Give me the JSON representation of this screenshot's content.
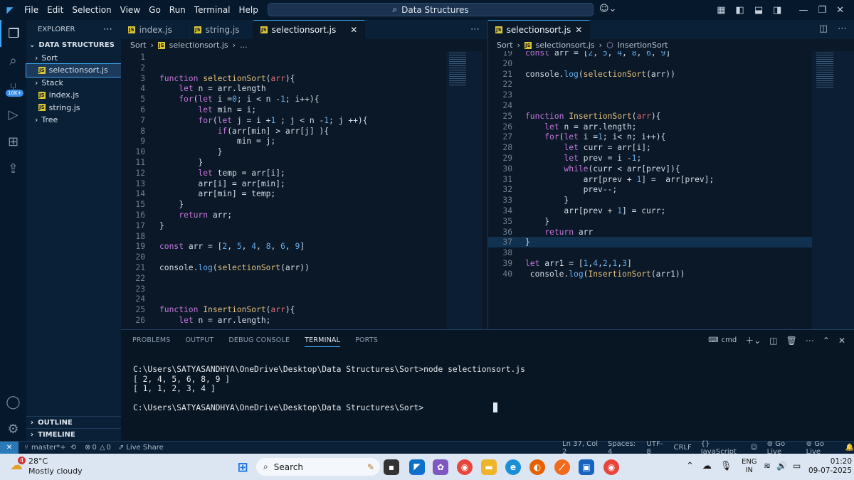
{
  "menu": [
    "File",
    "Edit",
    "Selection",
    "View",
    "Go",
    "Run",
    "Terminal",
    "Help"
  ],
  "search_text": "Data Structures",
  "explorer": {
    "title": "EXPLORER",
    "root": "DATA STRUCTURES",
    "items": [
      {
        "label": "Sort",
        "type": "folder",
        "depth": 0
      },
      {
        "label": "selectionsort.js",
        "type": "file",
        "depth": 1
      },
      {
        "label": "Stack",
        "type": "folder",
        "depth": 0
      },
      {
        "label": "index.js",
        "type": "file",
        "depth": 1
      },
      {
        "label": "string.js",
        "type": "file",
        "depth": 1
      },
      {
        "label": "Tree",
        "type": "folder",
        "depth": 0
      }
    ],
    "outline": "OUTLINE",
    "timeline": "TIMELINE"
  },
  "activity_badge": "10K+",
  "left_tabs": [
    "index.js",
    "string.js",
    "selectionsort.js"
  ],
  "left_breadcrumb": [
    "Sort",
    "selectionsort.js",
    "..."
  ],
  "right_tab": "selectionsort.js",
  "right_breadcrumb": [
    "Sort",
    "selectionsort.js",
    "InsertionSort"
  ],
  "left_code": [
    {
      "n": "1",
      "c": []
    },
    {
      "n": "2",
      "c": []
    },
    {
      "n": "3",
      "c": [
        [
          "k",
          "function "
        ],
        [
          "f",
          "selectionSort"
        ],
        [
          "p",
          "("
        ],
        [
          "v",
          "arr"
        ],
        [
          "p",
          "){"
        ]
      ]
    },
    {
      "n": "4",
      "c": [
        [
          "p",
          "    "
        ],
        [
          "k",
          "let "
        ],
        [
          "p",
          "n = arr.length"
        ]
      ]
    },
    {
      "n": "5",
      "c": [
        [
          "p",
          "    "
        ],
        [
          "k",
          "for"
        ],
        [
          "p",
          "("
        ],
        [
          "k",
          "let "
        ],
        [
          "p",
          "i ="
        ],
        [
          "n",
          "0"
        ],
        [
          "p",
          "; i < n -"
        ],
        [
          "n",
          "1"
        ],
        [
          "p",
          "; i++){"
        ]
      ]
    },
    {
      "n": "6",
      "c": [
        [
          "p",
          "        "
        ],
        [
          "k",
          "let "
        ],
        [
          "p",
          "min = i;"
        ]
      ]
    },
    {
      "n": "7",
      "c": [
        [
          "p",
          "        "
        ],
        [
          "k",
          "for"
        ],
        [
          "p",
          "("
        ],
        [
          "k",
          "let "
        ],
        [
          "p",
          "j = i +"
        ],
        [
          "n",
          "1"
        ],
        [
          "p",
          " ; j < n -"
        ],
        [
          "n",
          "1"
        ],
        [
          "p",
          "; j ++){"
        ]
      ]
    },
    {
      "n": "8",
      "c": [
        [
          "p",
          "            "
        ],
        [
          "k",
          "if"
        ],
        [
          "p",
          "(arr[min] > arr[j] ){"
        ]
      ]
    },
    {
      "n": "9",
      "c": [
        [
          "p",
          "                min = j;"
        ]
      ]
    },
    {
      "n": "10",
      "c": [
        [
          "p",
          "            }"
        ]
      ]
    },
    {
      "n": "11",
      "c": [
        [
          "p",
          "        }"
        ]
      ]
    },
    {
      "n": "12",
      "c": [
        [
          "p",
          "        "
        ],
        [
          "k",
          "let "
        ],
        [
          "p",
          "temp = arr[i];"
        ]
      ]
    },
    {
      "n": "13",
      "c": [
        [
          "p",
          "        arr[i] = arr[min];"
        ]
      ]
    },
    {
      "n": "14",
      "c": [
        [
          "p",
          "        arr[min] = temp;"
        ]
      ]
    },
    {
      "n": "15",
      "c": [
        [
          "p",
          "    }"
        ]
      ]
    },
    {
      "n": "16",
      "c": [
        [
          "p",
          "    "
        ],
        [
          "k",
          "return "
        ],
        [
          "p",
          "arr;"
        ]
      ]
    },
    {
      "n": "17",
      "c": [
        [
          "p",
          "}"
        ]
      ]
    },
    {
      "n": "18",
      "c": []
    },
    {
      "n": "19",
      "c": [
        [
          "k",
          "const "
        ],
        [
          "p",
          "arr = ["
        ],
        [
          "n",
          "2"
        ],
        [
          "p",
          ", "
        ],
        [
          "n",
          "5"
        ],
        [
          "p",
          ", "
        ],
        [
          "n",
          "4"
        ],
        [
          "p",
          ", "
        ],
        [
          "n",
          "8"
        ],
        [
          "p",
          ", "
        ],
        [
          "n",
          "6"
        ],
        [
          "p",
          ", "
        ],
        [
          "n",
          "9"
        ],
        [
          "p",
          "]"
        ]
      ]
    },
    {
      "n": "20",
      "c": []
    },
    {
      "n": "21",
      "c": [
        [
          "p",
          "console."
        ],
        [
          "n",
          "log"
        ],
        [
          "p",
          "("
        ],
        [
          "f",
          "selectionSort"
        ],
        [
          "p",
          "(arr))"
        ]
      ]
    },
    {
      "n": "22",
      "c": []
    },
    {
      "n": "23",
      "c": []
    },
    {
      "n": "24",
      "c": []
    },
    {
      "n": "25",
      "c": [
        [
          "k",
          "function "
        ],
        [
          "f",
          "InsertionSort"
        ],
        [
          "p",
          "("
        ],
        [
          "v",
          "arr"
        ],
        [
          "p",
          "){"
        ]
      ]
    },
    {
      "n": "26",
      "c": [
        [
          "p",
          "    "
        ],
        [
          "k",
          "let "
        ],
        [
          "p",
          "n = arr.length;"
        ]
      ]
    }
  ],
  "right_code": [
    {
      "n": "19",
      "c": [
        [
          "k",
          "const "
        ],
        [
          "p",
          "arr = ["
        ],
        [
          "n",
          "2"
        ],
        [
          "p",
          ", "
        ],
        [
          "n",
          "5"
        ],
        [
          "p",
          ", "
        ],
        [
          "n",
          "4"
        ],
        [
          "p",
          ", "
        ],
        [
          "n",
          "8"
        ],
        [
          "p",
          ", "
        ],
        [
          "n",
          "6"
        ],
        [
          "p",
          ", "
        ],
        [
          "n",
          "9"
        ],
        [
          "p",
          "]"
        ]
      ]
    },
    {
      "n": "20",
      "c": []
    },
    {
      "n": "21",
      "c": [
        [
          "p",
          "console."
        ],
        [
          "n",
          "log"
        ],
        [
          "p",
          "("
        ],
        [
          "f",
          "selectionSort"
        ],
        [
          "p",
          "(arr))"
        ]
      ]
    },
    {
      "n": "22",
      "c": []
    },
    {
      "n": "23",
      "c": []
    },
    {
      "n": "24",
      "c": []
    },
    {
      "n": "25",
      "c": [
        [
          "k",
          "function "
        ],
        [
          "f",
          "InsertionSort"
        ],
        [
          "p",
          "("
        ],
        [
          "v",
          "arr"
        ],
        [
          "p",
          "){"
        ]
      ]
    },
    {
      "n": "26",
      "c": [
        [
          "p",
          "    "
        ],
        [
          "k",
          "let "
        ],
        [
          "p",
          "n = arr.length;"
        ]
      ]
    },
    {
      "n": "27",
      "c": [
        [
          "p",
          "    "
        ],
        [
          "k",
          "for"
        ],
        [
          "p",
          "("
        ],
        [
          "k",
          "let "
        ],
        [
          "p",
          "i ="
        ],
        [
          "n",
          "1"
        ],
        [
          "p",
          "; i< n; i++){"
        ]
      ]
    },
    {
      "n": "28",
      "c": [
        [
          "p",
          "        "
        ],
        [
          "k",
          "let "
        ],
        [
          "p",
          "curr = arr[i];"
        ]
      ]
    },
    {
      "n": "29",
      "c": [
        [
          "p",
          "        "
        ],
        [
          "k",
          "let "
        ],
        [
          "p",
          "prev = i -"
        ],
        [
          "n",
          "1"
        ],
        [
          "p",
          ";"
        ]
      ]
    },
    {
      "n": "30",
      "c": [
        [
          "p",
          "        "
        ],
        [
          "k",
          "while"
        ],
        [
          "p",
          "(curr < arr[prev]){"
        ]
      ]
    },
    {
      "n": "31",
      "c": [
        [
          "p",
          "            arr[prev + "
        ],
        [
          "n",
          "1"
        ],
        [
          "p",
          "] =  arr[prev];"
        ]
      ]
    },
    {
      "n": "32",
      "c": [
        [
          "p",
          "            prev--;"
        ]
      ]
    },
    {
      "n": "33",
      "c": [
        [
          "p",
          "        }"
        ]
      ]
    },
    {
      "n": "34",
      "c": [
        [
          "p",
          "        arr[prev + "
        ],
        [
          "n",
          "1"
        ],
        [
          "p",
          "] = curr;"
        ]
      ]
    },
    {
      "n": "35",
      "c": [
        [
          "p",
          "    }"
        ]
      ]
    },
    {
      "n": "36",
      "c": [
        [
          "p",
          "    "
        ],
        [
          "k",
          "return "
        ],
        [
          "p",
          "arr"
        ]
      ]
    },
    {
      "n": "37",
      "c": [
        [
          "p",
          "}"
        ]
      ]
    },
    {
      "n": "38",
      "c": []
    },
    {
      "n": "39",
      "c": [
        [
          "k",
          "let "
        ],
        [
          "p",
          "arr1 = ["
        ],
        [
          "n",
          "1"
        ],
        [
          "p",
          ","
        ],
        [
          "n",
          "4"
        ],
        [
          "p",
          ","
        ],
        [
          "n",
          "2"
        ],
        [
          "p",
          ","
        ],
        [
          "n",
          "1"
        ],
        [
          "p",
          ","
        ],
        [
          "n",
          "3"
        ],
        [
          "p",
          "]"
        ]
      ]
    },
    {
      "n": "40",
      "c": [
        [
          "p",
          " console."
        ],
        [
          "n",
          "log"
        ],
        [
          "p",
          "("
        ],
        [
          "f",
          "InsertionSort"
        ],
        [
          "p",
          "(arr1))"
        ]
      ]
    }
  ],
  "panel": {
    "tabs": [
      "PROBLEMS",
      "OUTPUT",
      "DEBUG CONSOLE",
      "TERMINAL",
      "PORTS"
    ],
    "active_tab": "TERMINAL",
    "shell": "cmd",
    "terminal_lines": [
      "C:\\Users\\SATYASANDHYA\\OneDrive\\Desktop\\Data Structures\\Sort>node selectionsort.js",
      "[ 2, 4, 5, 6, 8, 9 ]",
      "[ 1, 1, 2, 3, 4 ]",
      "",
      "C:\\Users\\SATYASANDHYA\\OneDrive\\Desktop\\Data Structures\\Sort>"
    ]
  },
  "status": {
    "branch": "master*+",
    "problems": "0",
    "warnings": "0",
    "live_share": "Live Share",
    "position": "Ln 37, Col 2",
    "spaces": "Spaces: 4",
    "encoding": "UTF-8",
    "eol": "CRLF",
    "language": "JavaScript",
    "go_live_1": "Go Live",
    "go_live_2": "Go Live"
  },
  "taskbar": {
    "weather_temp": "28°C",
    "weather_desc": "Mostly cloudy",
    "weather_badge": "4",
    "search": "Search",
    "lang_1": "ENG",
    "lang_2": "IN",
    "time": "01:20",
    "date": "09-07-2025"
  },
  "colors": {
    "accent": "#3ea6f2",
    "keyword": "#c678dd",
    "function": "#e5c07b",
    "number": "#61afef",
    "param": "#e06c75"
  }
}
